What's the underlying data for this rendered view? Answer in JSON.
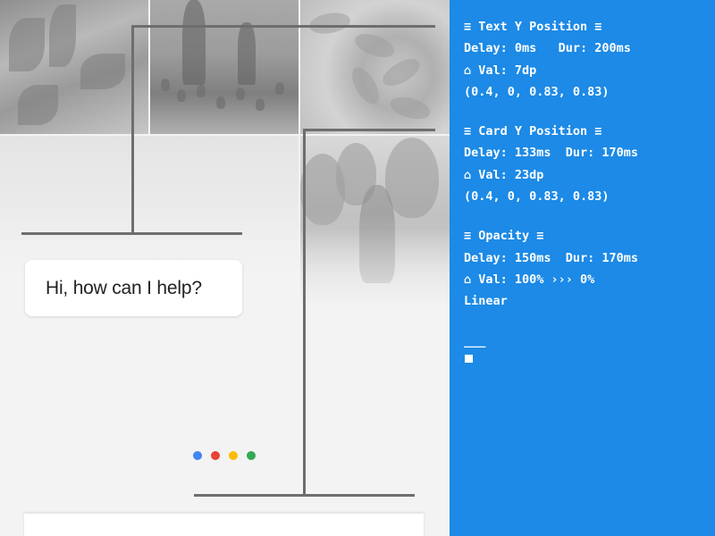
{
  "assistant": {
    "greeting": "Hi, how can I help?",
    "dots": [
      {
        "name": "blue-dot",
        "color": "#4285f4"
      },
      {
        "name": "red-dot",
        "color": "#ea4335"
      },
      {
        "name": "yellow-dot",
        "color": "#fbbc05"
      },
      {
        "name": "green-dot",
        "color": "#34a853"
      }
    ]
  },
  "spec": {
    "accent_color": "#1c8ae6",
    "sections": [
      {
        "title": "≡ Text Y Position ≡",
        "timing": "Delay: 0ms   Dur: 200ms",
        "value": "⌂ Val: 7dp",
        "easing": "(0.4, 0, 0.83, 0.83)"
      },
      {
        "title": "≡ Card Y Position ≡",
        "timing": "Delay: 133ms  Dur: 170ms",
        "value": "⌂ Val: 23dp",
        "easing": "(0.4, 0, 0.83, 0.83)"
      },
      {
        "title": "≡ Opacity ≡",
        "timing": "Delay: 150ms  Dur: 170ms",
        "value": "⌂ Val: 100% ››› 0%",
        "easing": "Linear"
      }
    ],
    "divider": "___"
  }
}
